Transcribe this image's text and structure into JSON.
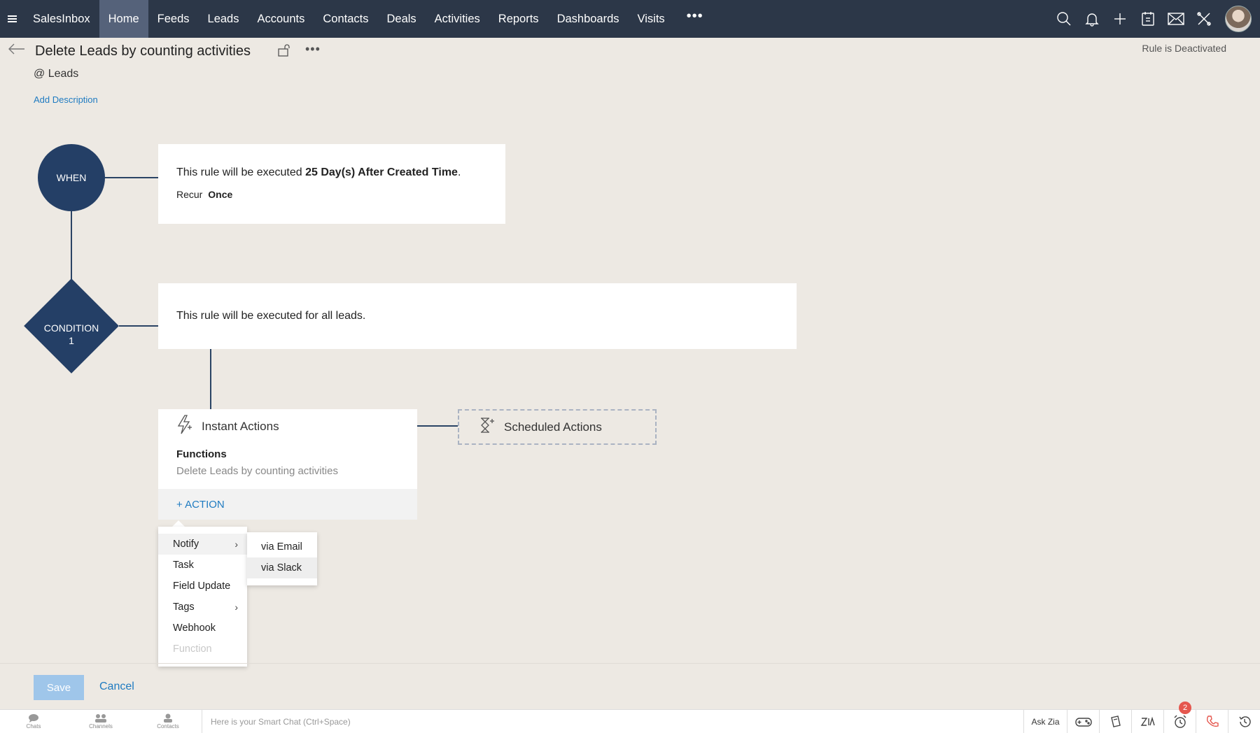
{
  "nav": {
    "brand": "SalesInbox",
    "items": [
      {
        "label": "Home",
        "active": true
      },
      {
        "label": "Feeds"
      },
      {
        "label": "Leads"
      },
      {
        "label": "Accounts"
      },
      {
        "label": "Contacts"
      },
      {
        "label": "Deals"
      },
      {
        "label": "Activities"
      },
      {
        "label": "Reports"
      },
      {
        "label": "Dashboards"
      },
      {
        "label": "Visits"
      }
    ],
    "more": "•••",
    "right_icons": [
      "search-icon",
      "bell-icon",
      "plus-icon",
      "calendar-icon",
      "mail-icon",
      "tools-icon",
      "avatar"
    ]
  },
  "header": {
    "title": "Delete Leads by counting activities",
    "more": "•••",
    "module": "@ Leads",
    "add_description": "Add Description",
    "status": "Rule is Deactivated"
  },
  "flow": {
    "when_label": "WHEN",
    "when_text_prefix": "This rule will be executed ",
    "when_text_bold": "25 Day(s) After Created Time",
    "when_text_suffix": ".",
    "recur_label": "Recur",
    "recur_value": "Once",
    "condition_label_line1": "CONDITION",
    "condition_label_line2": "1",
    "condition_text": "This rule will be executed for all leads.",
    "instant_actions_title": "Instant Actions",
    "functions_title": "Functions",
    "functions_value": "Delete Leads by counting activities",
    "add_action": "+ ACTION",
    "scheduled_actions_title": "Scheduled Actions"
  },
  "action_menu": {
    "items": [
      {
        "label": "Notify",
        "has_submenu": true
      },
      {
        "label": "Task"
      },
      {
        "label": "Field Update"
      },
      {
        "label": "Tags",
        "has_submenu": true
      },
      {
        "label": "Webhook"
      },
      {
        "label": "Function",
        "disabled": true
      }
    ],
    "submenu": [
      {
        "label": "via Email"
      },
      {
        "label": "via Slack",
        "highlighted": true
      }
    ]
  },
  "footer": {
    "save": "Save",
    "cancel": "Cancel"
  },
  "bottom_bar": {
    "chats": "Chats",
    "channels": "Channels",
    "contacts": "Contacts",
    "smart_chat_placeholder": "Here is your Smart Chat (Ctrl+Space)",
    "ask_zia": "Ask Zia",
    "notification_count": "2"
  },
  "colors": {
    "nav_bg": "#2c3748",
    "nav_active": "#55627a",
    "node": "#243f66",
    "link": "#1f7bc1",
    "save_disabled": "#9fc6ea",
    "badge": "#e5574e"
  }
}
